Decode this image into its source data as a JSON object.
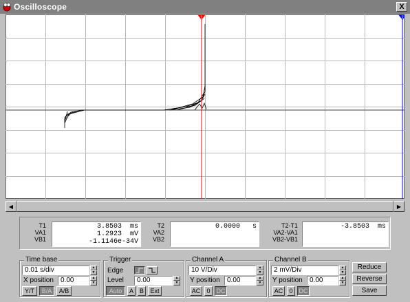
{
  "window": {
    "title": "Oscilloscope",
    "close_glyph": "X"
  },
  "cursors": {
    "t1_marker": "1",
    "t2_marker": "2"
  },
  "readout": {
    "t1_labels": [
      "T1",
      "VA1",
      "VB1"
    ],
    "t1_values": [
      "3.8503  ms",
      "1.2923  mV",
      "-1.1146e-34V"
    ],
    "t2_labels": [
      "T2",
      "VA2",
      "VB2"
    ],
    "t2_values": [
      "0.0000   s",
      "",
      ""
    ],
    "diff_labels": [
      "T2-T1",
      "VA2-VA1",
      "VB2-VB1"
    ],
    "diff_values": [
      "-3.8503  ms",
      "",
      ""
    ]
  },
  "timebase": {
    "title": "Time base",
    "value": "0.01 s/div",
    "xpos_label": "X position",
    "xpos_value": "0.00",
    "modes": [
      "Y/T",
      "B/A",
      "A/B"
    ]
  },
  "trigger": {
    "title": "Trigger",
    "edge_label": "Edge",
    "level_label": "Level",
    "level_value": "0.00",
    "buttons": [
      "Auto",
      "A",
      "B",
      "Ext"
    ]
  },
  "channel_a": {
    "title": "Channel A",
    "value": "10  V/Div",
    "ypos_label": "Y position",
    "ypos_value": "0.00",
    "coupling": [
      "AC",
      "0",
      "DC"
    ]
  },
  "channel_b": {
    "title": "Channel B",
    "value": "2  mV/Div",
    "ypos_label": "Y position",
    "ypos_value": "0.00",
    "coupling": [
      "AC",
      "0",
      "DC"
    ]
  },
  "actions": {
    "reduce": "Reduce",
    "reverse": "Reverse",
    "save": "Save"
  },
  "colors": {
    "grid": "#b8b8b8",
    "cursor1": "#ff0000",
    "cursor2": "#0000ff",
    "trace": "#000000",
    "titlebar": "#808080"
  }
}
